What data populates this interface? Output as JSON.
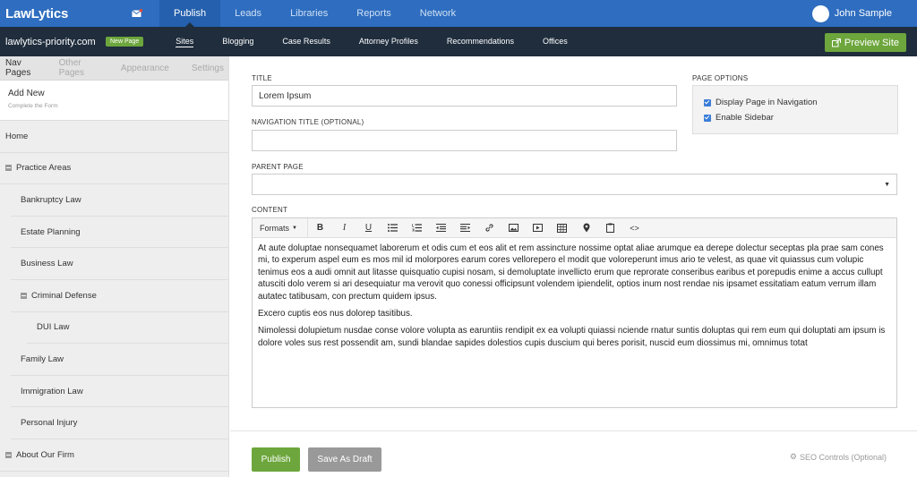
{
  "topbar": {
    "logo": "LawLytics",
    "nav": [
      "Publish",
      "Leads",
      "Libraries",
      "Reports",
      "Network"
    ],
    "user_name": "John Sample"
  },
  "subbar": {
    "site": "lawlytics-priority.com",
    "badge": "New Page",
    "nav": [
      "Sites",
      "Blogging",
      "Case Results",
      "Attorney Profiles",
      "Recommendations",
      "Offices"
    ],
    "preview": "Preview Site"
  },
  "sidebar": {
    "tabs": [
      "Nav Pages",
      "Other Pages",
      "Appearance",
      "Settings"
    ],
    "add_new": "Add New",
    "add_new_sub": "Complete the Form",
    "items": [
      {
        "label": "Home"
      },
      {
        "label": "Practice Areas"
      },
      {
        "label": "Bankruptcy Law"
      },
      {
        "label": "Estate Planning"
      },
      {
        "label": "Business Law"
      },
      {
        "label": "Criminal Defense"
      },
      {
        "label": "DUI Law"
      },
      {
        "label": "Family Law"
      },
      {
        "label": "Immigration Law"
      },
      {
        "label": "Personal Injury"
      },
      {
        "label": "About Our Firm"
      }
    ]
  },
  "form": {
    "title_label": "TITLE",
    "title_value": "Lorem Ipsum",
    "nav_title_label": "NAVIGATION TITLE (OPTIONAL)",
    "nav_title_value": "",
    "parent_label": "PARENT PAGE",
    "parent_value": "",
    "content_label": "CONTENT",
    "formats": "Formats"
  },
  "options": {
    "heading": "PAGE OPTIONS",
    "display_nav": "Display Page in Navigation",
    "enable_sidebar": "Enable Sidebar"
  },
  "content": {
    "p1": "At aute doluptae nonsequamet laborerum et odis cum et eos alit et rem assincture nossime optat aliae arumque ea derepe dolectur seceptas pla prae sam cones mi, to experum aspel eum es mos mil id molorpores earum cores vellorepero el modit que voloreperunt imus ario te velest, as quae vit quiassus cum volupic tenimus eos a audi omnit aut litasse quisquatio cupisi nosam, si demoluptate invellicto erum que reprorate conseribus earibus et porepudis enime a accus cullupt atusciti dolo verem si ari desequiatur ma verovit quo conessi officipsunt volendem ipiendelit, optios inum nost rendae nis ipsamet essitatiam eatum verrum illam autatec tatibusam, con prectum quidem ipsus.",
    "p2": "Excero cuptis eos nus dolorep tasitibus.",
    "p3": "Nimolessi dolupietum nusdae conse volore volupta as earuntiis rendipit ex ea volupti quiassi nciende rnatur suntis doluptas qui rem eum qui doluptati am ipsum is dolore voles sus rest possendit am, sundi blandae sapides dolestios cupis duscium qui beres porisit, nuscid eum diossimus mi, omnimus totat"
  },
  "actions": {
    "publish": "Publish",
    "draft": "Save As Draft",
    "seo": "SEO Controls (Optional)"
  },
  "colors": {
    "topbar": "#2e6dbf",
    "subbar": "#1f2d3d",
    "accent_green": "#6da63c"
  }
}
